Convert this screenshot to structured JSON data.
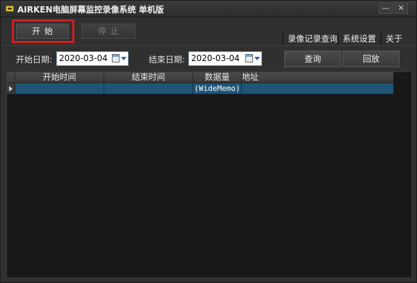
{
  "window": {
    "title": "AIRKEN电脑屏幕监控录像系统 单机版",
    "minimize_label": "—",
    "close_label": "✕"
  },
  "controls": {
    "start_label": "开始",
    "stop_label": "停止"
  },
  "tabs": [
    {
      "label": "录像记录查询"
    },
    {
      "label": "系统设置"
    },
    {
      "label": "关于"
    }
  ],
  "filters": {
    "start_date_label": "开始日期:",
    "start_date_value": "2020-03-04",
    "end_date_label": "结束日期:",
    "end_date_value": "2020-03-04",
    "query_label": "查询",
    "playback_label": "回放"
  },
  "grid": {
    "columns": [
      "开始时间",
      "结束时间",
      "数据量",
      "地址"
    ],
    "rows": [
      {
        "start_time": "",
        "end_time": "",
        "data_size": "(WideMemo)"
      }
    ]
  },
  "colors": {
    "highlight_border": "#d21e1e",
    "selected_row": "#1f5577"
  }
}
